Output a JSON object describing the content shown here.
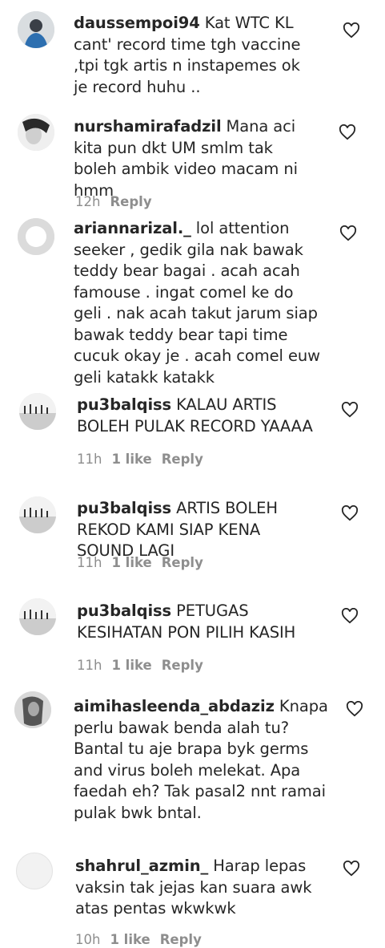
{
  "comments": [
    {
      "username": "daussempoi94",
      "text": "Kat WTC KL cant' record time tgh vaccine ,tpi tgk artis n instapemes ok je record huhu ..",
      "time": "",
      "likes": "",
      "reply": "",
      "avatar_icon": "profile-photo"
    },
    {
      "username": "nurshamirafadzil",
      "text": "Mana aci kita pun dkt UM smlm tak boleh ambik video macam ni hmm",
      "time": "12h",
      "likes": "",
      "reply": "Reply",
      "avatar_icon": "profile-photo"
    },
    {
      "username": "ariannarizal._",
      "text": "lol attention seeker , gedik gila nak bawak teddy bear bagai . acah acah famouse . ingat comel ke do geli . nak acah takut jarum siap bawak teddy bear tapi time cucuk okay je . acah comel euw geli katakk katakk",
      "time": "",
      "likes": "",
      "reply": "",
      "avatar_icon": "default-avatar"
    },
    {
      "username": "pu3balqiss",
      "text": "KALAU ARTIS BOLEH PULAK RECORD YAAAA",
      "time": "11h",
      "likes": "1 like",
      "reply": "Reply",
      "avatar_icon": "profile-photo"
    },
    {
      "username": "pu3balqiss",
      "text": "ARTIS BOLEH REKOD KAMI SIAP KENA SOUND LAGI",
      "time": "11h",
      "likes": "1 like",
      "reply": "Reply",
      "avatar_icon": "profile-photo"
    },
    {
      "username": "pu3balqiss",
      "text": "PETUGAS KESIHATAN PON PILIH KASIH",
      "time": "11h",
      "likes": "1 like",
      "reply": "Reply",
      "avatar_icon": "profile-photo"
    },
    {
      "username": "aimihasleenda_abdaziz",
      "text": "Knapa perlu bawak benda alah tu? Bantal tu aje brapa byk germs and virus boleh melekat. Apa faedah eh? Tak pasal2 nnt ramai pulak bwk bntal.",
      "time": "",
      "likes": "",
      "reply": "",
      "avatar_icon": "profile-photo"
    },
    {
      "username": "shahrul_azmin_",
      "text": "Harap lepas vaksin tak jejas kan suara awk atas pentas wkwkwk",
      "time": "10h",
      "likes": "1 like",
      "reply": "Reply",
      "avatar_icon": "default-avatar"
    }
  ],
  "colors": {
    "text": "#262626",
    "muted": "#8e8e8e",
    "background": "#ffffff"
  }
}
